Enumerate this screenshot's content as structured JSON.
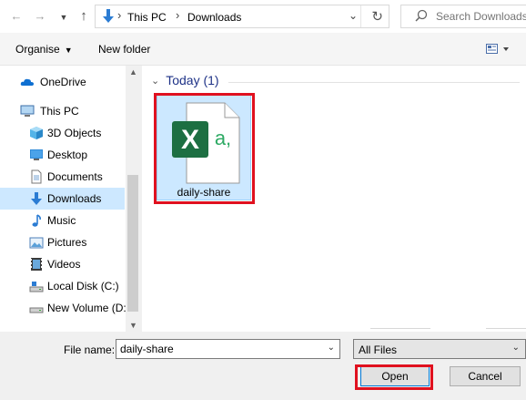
{
  "address": {
    "back_icon": "arrow-left-icon",
    "forward_icon": "arrow-right-icon",
    "up_icon": "arrow-up-icon",
    "breadcrumb": [
      "This PC",
      "Downloads"
    ],
    "refresh_icon": "refresh-icon"
  },
  "search": {
    "placeholder": "Search Downloads"
  },
  "toolbar": {
    "organise_label": "Organise",
    "new_folder_label": "New folder",
    "view_icon": "view-options-icon"
  },
  "sidebar": {
    "items": [
      {
        "label": "OneDrive",
        "icon": "cloud-icon"
      },
      {
        "label": "This PC",
        "icon": "computer-icon"
      },
      {
        "label": "3D Objects",
        "icon": "cube-icon"
      },
      {
        "label": "Desktop",
        "icon": "desktop-icon"
      },
      {
        "label": "Documents",
        "icon": "document-icon"
      },
      {
        "label": "Downloads",
        "icon": "download-icon",
        "selected": true
      },
      {
        "label": "Music",
        "icon": "music-icon"
      },
      {
        "label": "Pictures",
        "icon": "pictures-icon"
      },
      {
        "label": "Videos",
        "icon": "video-icon"
      },
      {
        "label": "Local Disk (C:)",
        "icon": "drive-icon"
      },
      {
        "label": "New Volume (D:",
        "icon": "drive-icon"
      }
    ]
  },
  "content": {
    "group_label": "Today (1)",
    "files": [
      {
        "name": "daily-share",
        "icon": "excel-csv-icon"
      }
    ]
  },
  "footer": {
    "file_name_label": "File name:",
    "file_name_value": "daily-share",
    "file_type_value": "All Files",
    "open_label": "Open",
    "cancel_label": "Cancel"
  },
  "colors": {
    "highlight": "#e0111f",
    "selection": "#cce8ff",
    "excel_green": "#1d6f42"
  }
}
